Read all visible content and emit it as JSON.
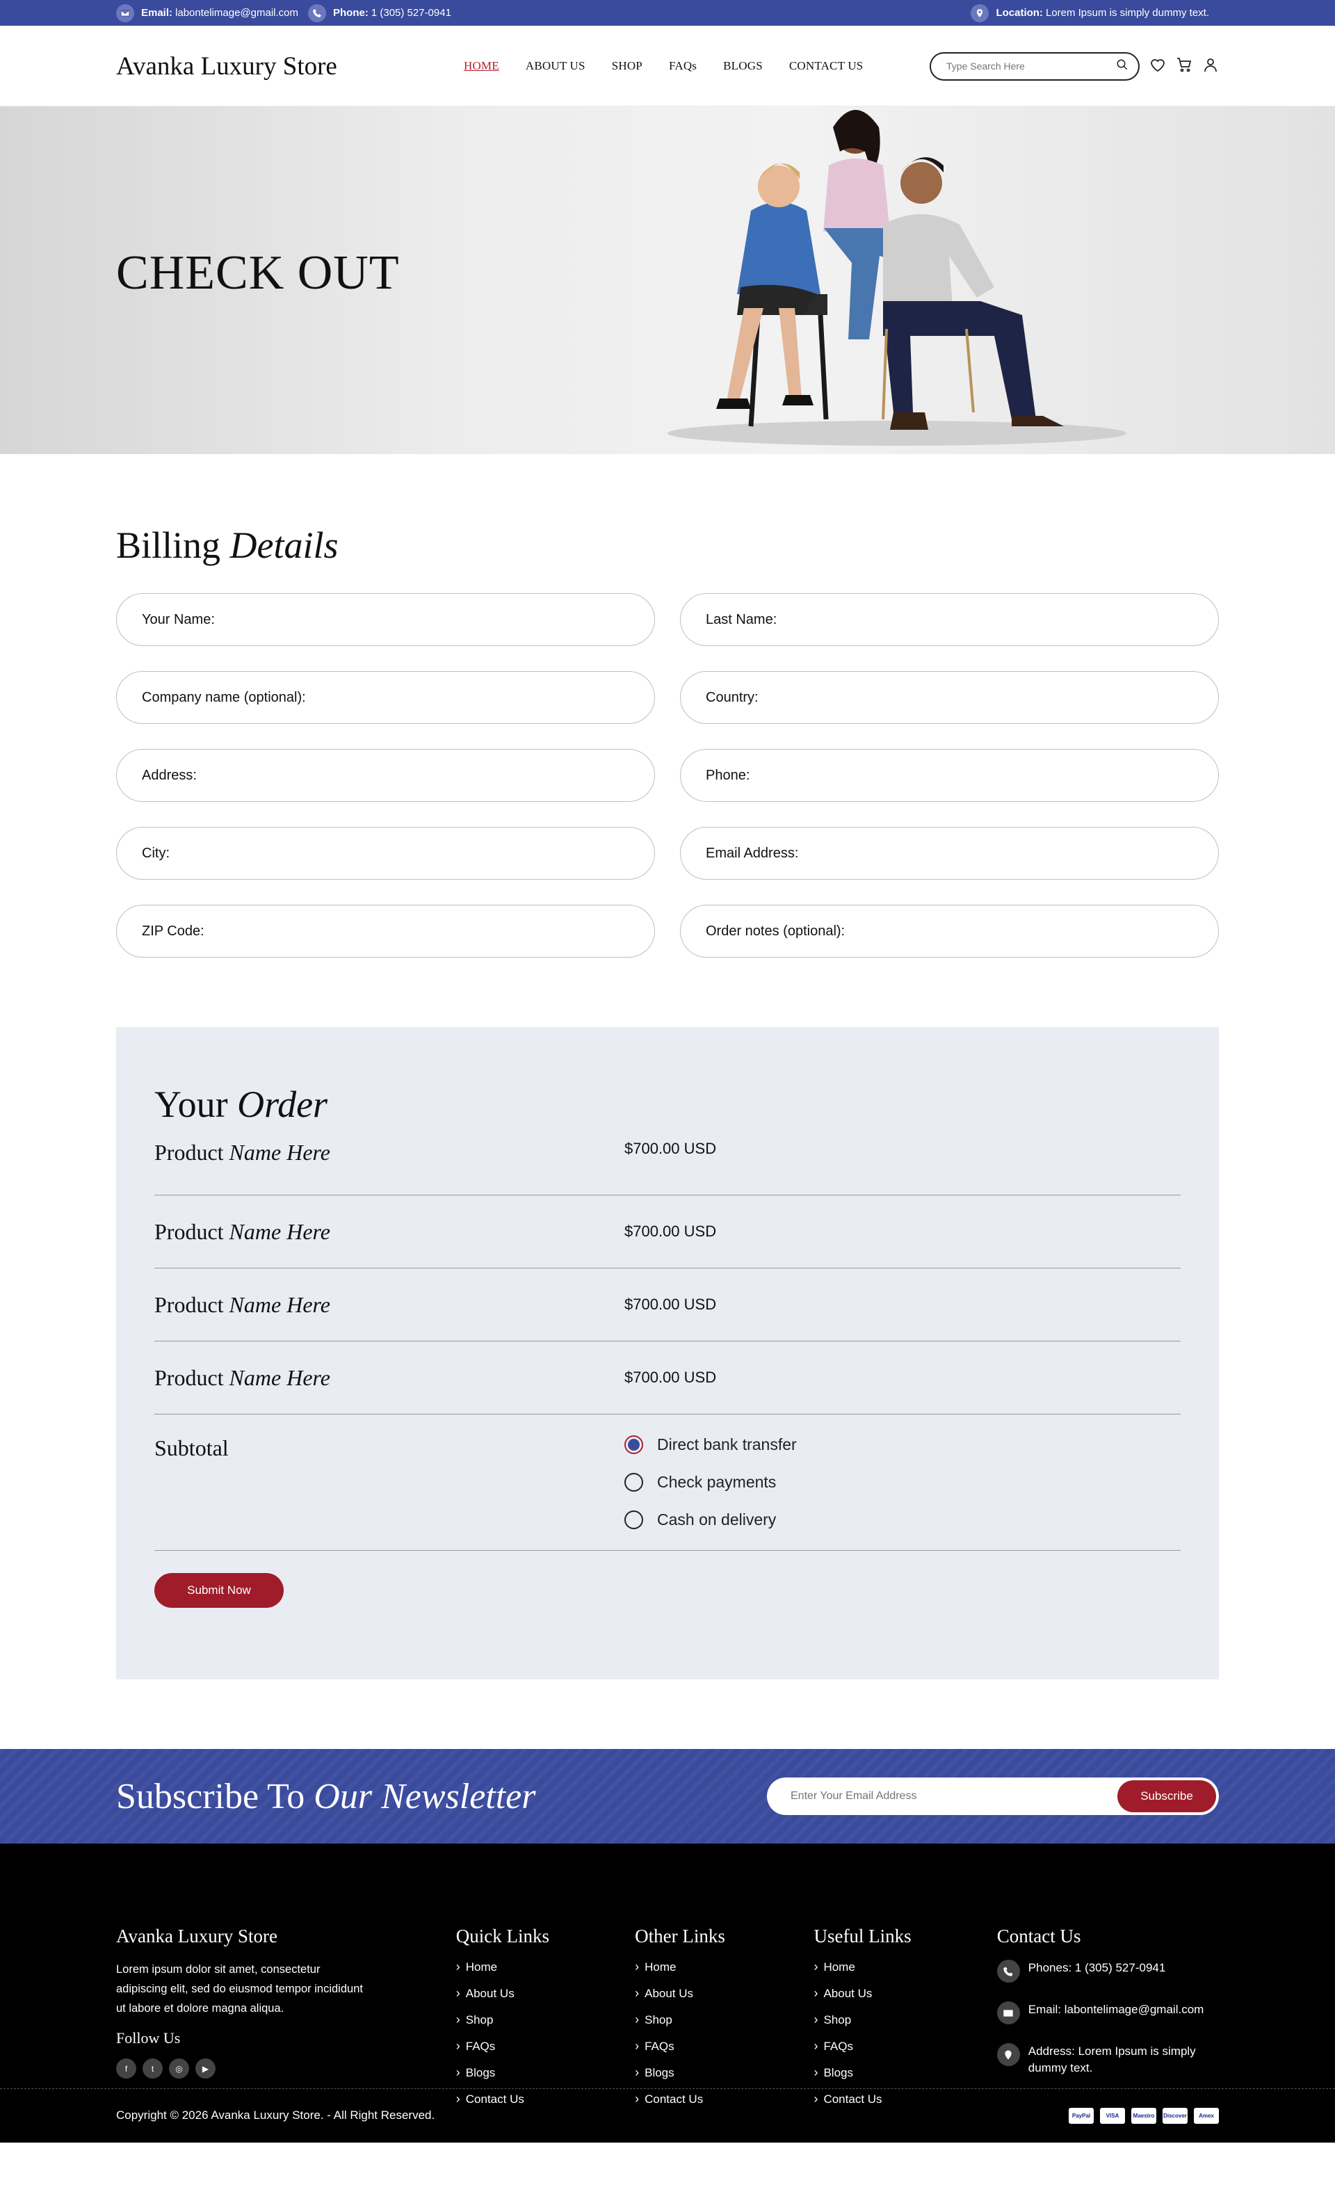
{
  "topbar": {
    "email_label": "Email:",
    "email_value": "labontelimage@gmail.com",
    "phone_label": "Phone:",
    "phone_value": "1 (305) 527-0941",
    "location_label": "Location:",
    "location_value": "Lorem Ipsum is simply dummy text."
  },
  "header": {
    "logo": "Avanka Luxury Store",
    "nav": [
      "HOME",
      "ABOUT US",
      "SHOP",
      "FAQs",
      "BLOGS",
      "CONTACT US"
    ],
    "search_placeholder": "Type Search Here"
  },
  "hero": {
    "title": "CHECK OUT"
  },
  "billing": {
    "title_a": "Billing",
    "title_b": "Details",
    "fields": [
      "Your Name:",
      "Last Name:",
      "Company name (optional):",
      "Country:",
      "Address:",
      "Phone:",
      "City:",
      "Email Address:",
      "ZIP Code:",
      "Order notes (optional):"
    ]
  },
  "order": {
    "title_a": "Your",
    "title_b": "Order",
    "items": [
      {
        "name_a": "Product",
        "name_b": "Name Here",
        "price": "$700.00 USD"
      },
      {
        "name_a": "Product",
        "name_b": "Name Here",
        "price": "$700.00 USD"
      },
      {
        "name_a": "Product",
        "name_b": "Name Here",
        "price": "$700.00 USD"
      },
      {
        "name_a": "Product",
        "name_b": "Name Here",
        "price": "$700.00 USD"
      }
    ],
    "subtotal_label": "Subtotal",
    "payment_options": [
      {
        "label": "Direct bank transfer",
        "selected": true
      },
      {
        "label": "Check payments",
        "selected": false
      },
      {
        "label": "Cash on delivery",
        "selected": false
      }
    ],
    "submit_label": "Submit Now"
  },
  "newsletter": {
    "title_a": "Subscribe To",
    "title_b": "Our Newsletter",
    "placeholder": "Enter Your Email Address",
    "button": "Subscribe"
  },
  "footer": {
    "brand": "Avanka Luxury Store",
    "about": "Lorem ipsum dolor sit amet, consectetur adipiscing elit, sed do eiusmod tempor incididunt ut labore et dolore magna aliqua.",
    "follow": "Follow Us",
    "socials": [
      "facebook-icon",
      "twitter-icon",
      "instagram-icon",
      "youtube-icon"
    ],
    "quick_title": "Quick Links",
    "other_title": "Other Links",
    "useful_title": "Useful Links",
    "links": [
      "Home",
      "About Us",
      "Shop",
      "FAQs",
      "Blogs",
      "Contact Us"
    ],
    "contact_title": "Contact Us",
    "contact_phone": "Phones: 1 (305) 527-0941",
    "contact_email": "Email: labontelimage@gmail.com",
    "contact_address": "Address: Lorem Ipsum is simply dummy text.",
    "copyright": "Copyright © 2026 Avanka Luxury Store. - All Right Reserved.",
    "payments": [
      "PayPal",
      "VISA",
      "Maestro",
      "Discover",
      "Amex"
    ]
  },
  "colors": {
    "brand_blue": "#3a4a9c",
    "accent_red": "#a01c2a",
    "order_bg": "#eaecf4"
  }
}
